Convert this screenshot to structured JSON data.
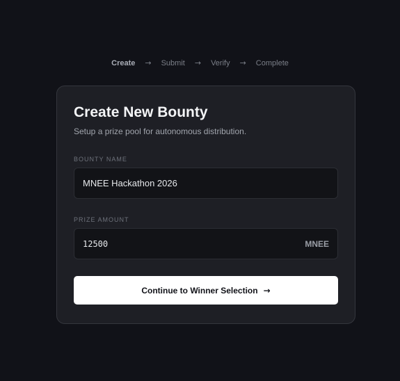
{
  "stepper": {
    "steps": [
      {
        "label": "Create",
        "active": true
      },
      {
        "label": "Submit",
        "active": false
      },
      {
        "label": "Verify",
        "active": false
      },
      {
        "label": "Complete",
        "active": false
      }
    ],
    "separator": "→"
  },
  "card": {
    "title": "Create New Bounty",
    "subtitle": "Setup a prize pool for autonomous distribution."
  },
  "form": {
    "bounty_name": {
      "label": "BOUNTY NAME",
      "value": "MNEE Hackathon 2026"
    },
    "prize_amount": {
      "label": "PRIZE AMOUNT",
      "value": "12500",
      "suffix": "MNEE"
    },
    "submit": {
      "label": "Continue to Winner Selection",
      "icon": "arrow-right-icon",
      "glyph": "→"
    }
  },
  "colors": {
    "background": "#111218",
    "card": "#1e1f25",
    "input": "#121317",
    "button": "#ffffff"
  }
}
